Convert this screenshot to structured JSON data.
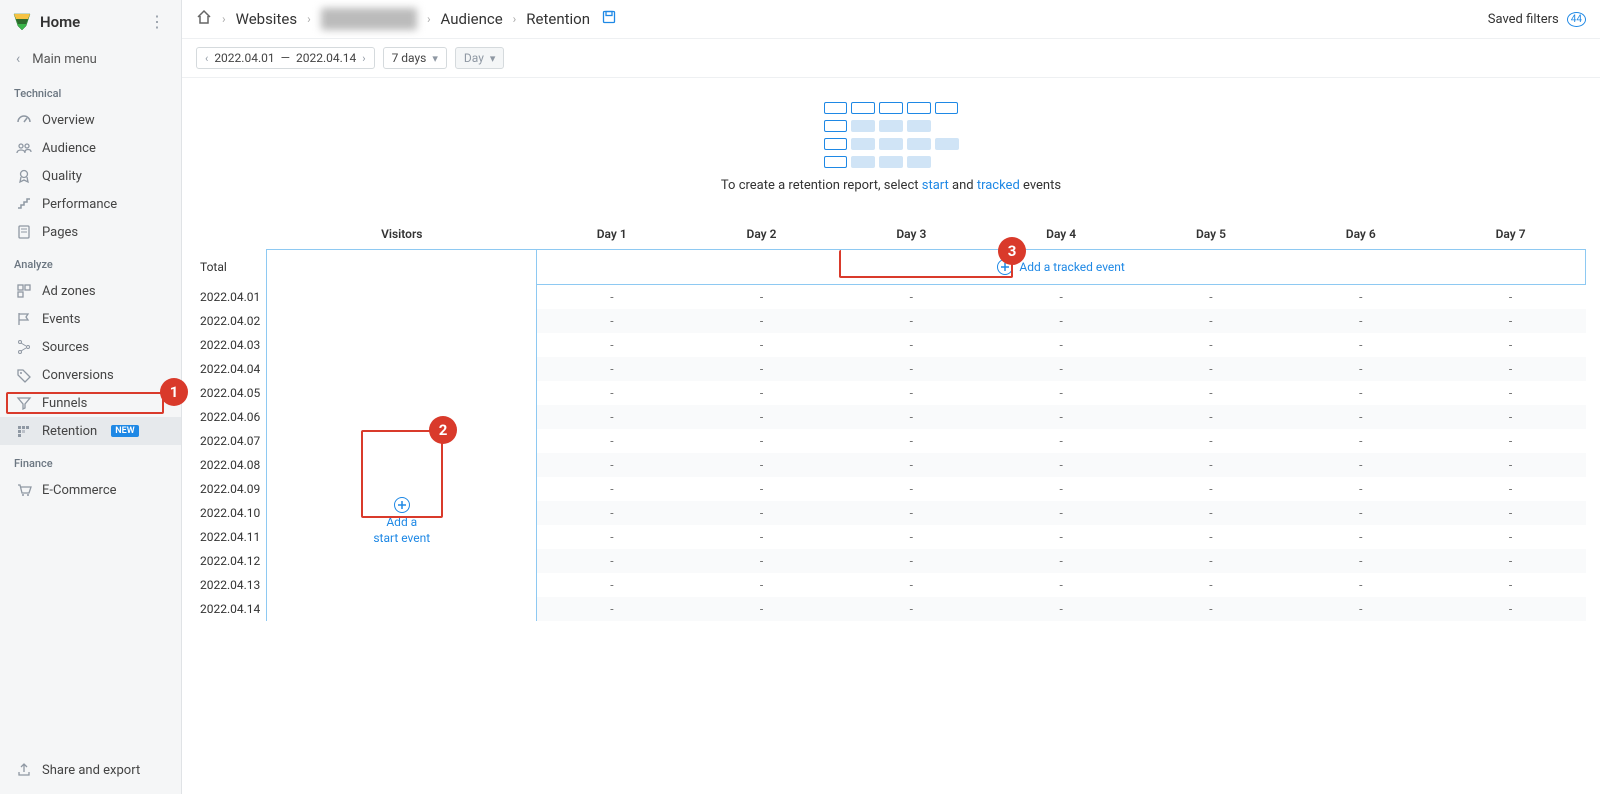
{
  "sidebar": {
    "title": "Home",
    "main_menu": "Main menu",
    "section_technical": "Technical",
    "section_analyze": "Analyze",
    "section_finance": "Finance",
    "items": {
      "overview": "Overview",
      "audience": "Audience",
      "quality": "Quality",
      "performance": "Performance",
      "pages": "Pages",
      "adzones": "Ad zones",
      "events": "Events",
      "sources": "Sources",
      "conversions": "Conversions",
      "funnels": "Funnels",
      "retention": "Retention",
      "retention_badge": "NEW",
      "ecommerce": "E-Commerce"
    },
    "share_export": "Share and export"
  },
  "breadcrumb": {
    "websites": "Websites",
    "site": "████████████",
    "audience": "Audience",
    "retention": "Retention"
  },
  "topbar": {
    "saved_filters": "Saved filters",
    "saved_filters_count": "44"
  },
  "filters": {
    "date_from": "2022.04.01",
    "date_sep": "—",
    "date_to": "2022.04.14",
    "period": "7 days",
    "granularity": "Day"
  },
  "placeholder": {
    "text_prefix": "To create a retention report, select ",
    "link_start": "start",
    "text_mid": " and ",
    "link_tracked": "tracked",
    "text_suffix": " events"
  },
  "table": {
    "col_visitors": "Visitors",
    "day_prefix": "Day ",
    "days": [
      "1",
      "2",
      "3",
      "4",
      "5",
      "6",
      "7"
    ],
    "total_label": "Total",
    "add_tracked": "Add a tracked event",
    "add_start_line1": "Add a",
    "add_start_line2": "start event",
    "dates": [
      "2022.04.01",
      "2022.04.02",
      "2022.04.03",
      "2022.04.04",
      "2022.04.05",
      "2022.04.06",
      "2022.04.07",
      "2022.04.08",
      "2022.04.09",
      "2022.04.10",
      "2022.04.11",
      "2022.04.12",
      "2022.04.13",
      "2022.04.14"
    ],
    "empty": "-"
  },
  "callouts": {
    "c1": "1",
    "c2": "2",
    "c3": "3"
  }
}
